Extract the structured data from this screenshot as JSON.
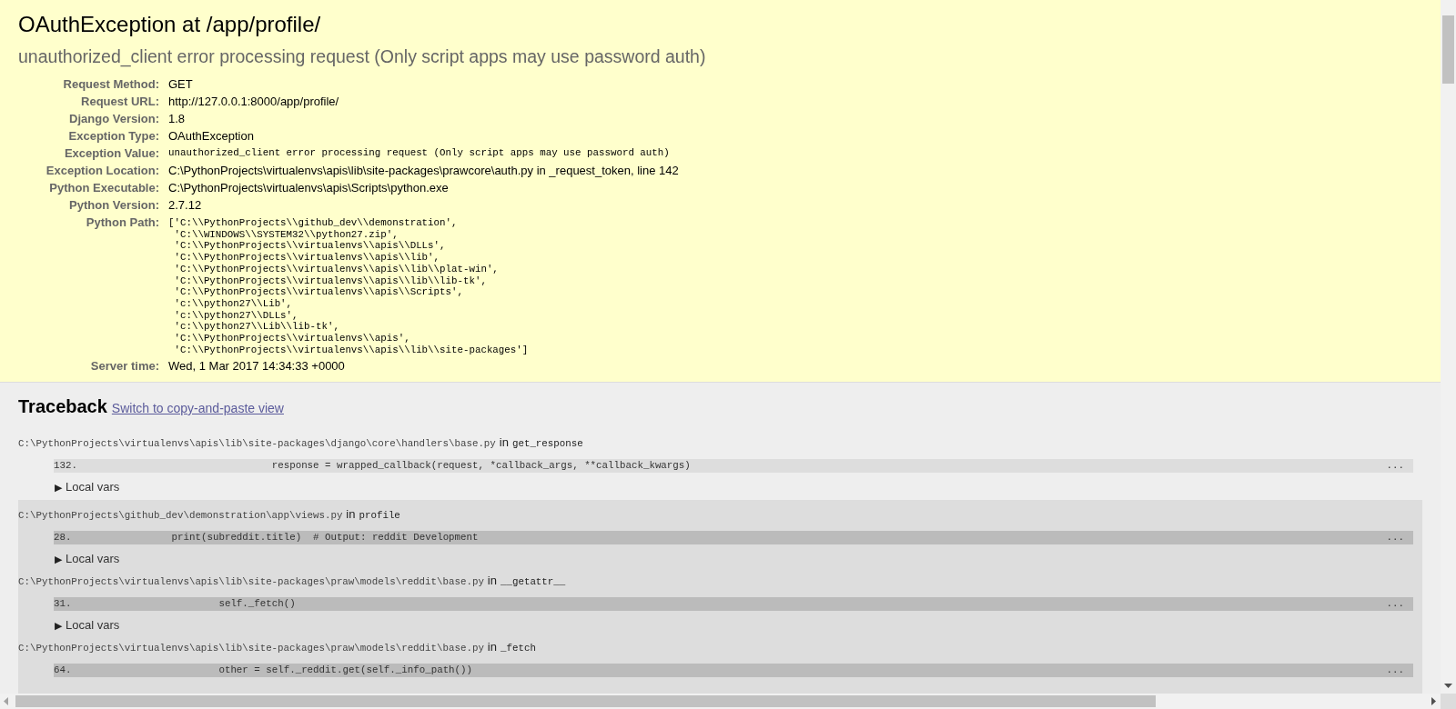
{
  "summary": {
    "title": "OAuthException at /app/profile/",
    "subtitle": "unauthorized_client error processing request (Only script apps may use password auth)",
    "meta": [
      {
        "kind": "text",
        "label": "Request Method:",
        "value": "GET"
      },
      {
        "kind": "text",
        "label": "Request URL:",
        "value": "http://127.0.0.1:8000/app/profile/"
      },
      {
        "kind": "text",
        "label": "Django Version:",
        "value": "1.8"
      },
      {
        "kind": "text",
        "label": "Exception Type:",
        "value": "OAuthException"
      },
      {
        "kind": "code",
        "label": "Exception Value:",
        "value": "unauthorized_client error processing request (Only script apps may use password auth)"
      },
      {
        "kind": "text",
        "label": "Exception Location:",
        "value": "C:\\PythonProjects\\virtualenvs\\apis\\lib\\site-packages\\prawcore\\auth.py in _request_token, line 142"
      },
      {
        "kind": "text",
        "label": "Python Executable:",
        "value": "C:\\PythonProjects\\virtualenvs\\apis\\Scripts\\python.exe"
      },
      {
        "kind": "text",
        "label": "Python Version:",
        "value": "2.7.12"
      },
      {
        "kind": "lines",
        "label": "Python Path:",
        "lines": [
          "['C:\\\\PythonProjects\\\\github_dev\\\\demonstration',",
          " 'C:\\\\WINDOWS\\\\SYSTEM32\\\\python27.zip',",
          " 'C:\\\\PythonProjects\\\\virtualenvs\\\\apis\\\\DLLs',",
          " 'C:\\\\PythonProjects\\\\virtualenvs\\\\apis\\\\lib',",
          " 'C:\\\\PythonProjects\\\\virtualenvs\\\\apis\\\\lib\\\\plat-win',",
          " 'C:\\\\PythonProjects\\\\virtualenvs\\\\apis\\\\lib\\\\lib-tk',",
          " 'C:\\\\PythonProjects\\\\virtualenvs\\\\apis\\\\Scripts',",
          " 'c:\\\\python27\\\\Lib',",
          " 'c:\\\\python27\\\\DLLs',",
          " 'c:\\\\python27\\\\Lib\\\\lib-tk',",
          " 'C:\\\\PythonProjects\\\\virtualenvs\\\\apis',",
          " 'C:\\\\PythonProjects\\\\virtualenvs\\\\apis\\\\lib\\\\site-packages']"
        ]
      },
      {
        "kind": "text",
        "label": "Server time:",
        "value": "Wed, 1 Mar 2017 14:34:33 +0000"
      }
    ]
  },
  "traceback": {
    "title": "Traceback",
    "link": "Switch to copy-and-paste view",
    "frames": [
      {
        "kind": "django",
        "file": "C:\\PythonProjects\\virtualenvs\\apis\\lib\\site-packages\\django\\core\\handlers\\base.py",
        "in": "in",
        "function": "get_response",
        "line_number": "132.",
        "code": "                                response = wrapped_callback(request, *callback_args, **callback_kwargs)",
        "ellipsis": "...",
        "local_vars": {
          "arrow": "▶",
          "label": "Local vars"
        }
      },
      {
        "kind": "user",
        "file": "C:\\PythonProjects\\github_dev\\demonstration\\app\\views.py",
        "in": "in",
        "function": "profile",
        "line_number": "28.",
        "code": "                print(subreddit.title)  # Output: reddit Development",
        "ellipsis": "...",
        "local_vars": {
          "arrow": "▶",
          "label": "Local vars"
        }
      },
      {
        "kind": "user",
        "file": "C:\\PythonProjects\\virtualenvs\\apis\\lib\\site-packages\\praw\\models\\reddit\\base.py",
        "in": "in",
        "function": "__getattr__",
        "line_number": "31.",
        "code": "                        self._fetch()",
        "ellipsis": "...",
        "local_vars": {
          "arrow": "▶",
          "label": "Local vars"
        }
      },
      {
        "kind": "user",
        "file": "C:\\PythonProjects\\virtualenvs\\apis\\lib\\site-packages\\praw\\models\\reddit\\base.py",
        "in": "in",
        "function": "_fetch",
        "line_number": "64.",
        "code": "                        other = self._reddit.get(self._info_path())",
        "ellipsis": "..."
      }
    ]
  }
}
